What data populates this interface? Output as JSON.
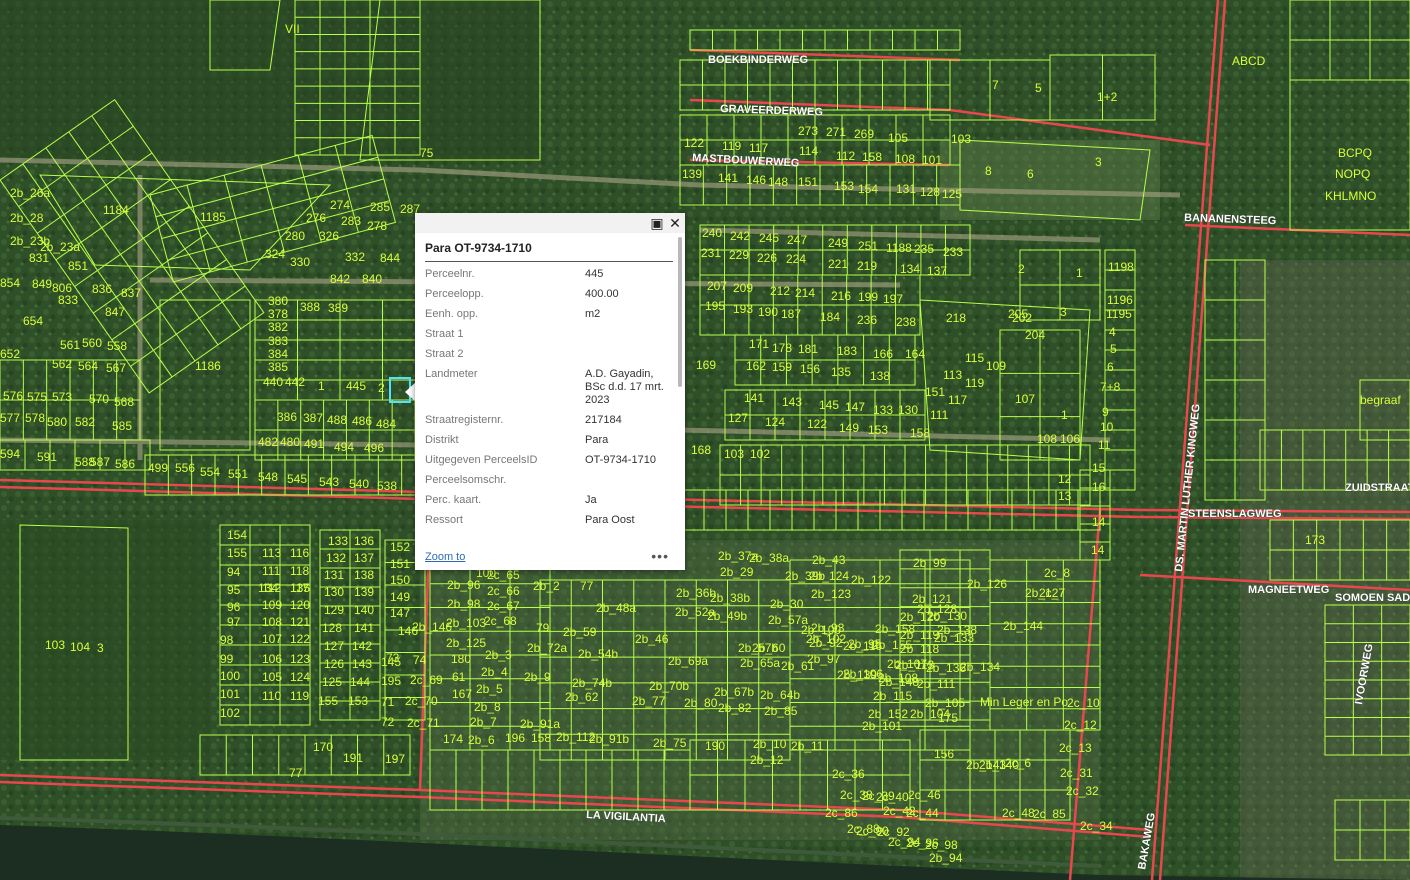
{
  "map": {
    "colors": {
      "parcel": "#b8ff4a",
      "road": "#e8474d",
      "label": "#d8ff3a",
      "highlight": "#4fe3ff"
    },
    "road_labels": [
      {
        "id": "boekbinderweg",
        "text": "BOEKBINDERWEG"
      },
      {
        "id": "graveerderweg",
        "text": "GRAVEERDERWEG"
      },
      {
        "id": "mastbouwerweg",
        "text": "MASTBOUWERWEG"
      },
      {
        "id": "bananensteeg",
        "text": "BANANENSTEEG"
      },
      {
        "id": "ds-martin-luther-kingweg",
        "text": "DS. MARTIN LUTHER KINGWEG"
      },
      {
        "id": "steenslagweg",
        "text": "STEENSLAGWEG"
      },
      {
        "id": "zuidstraat",
        "text": "ZUIDSTRAAT"
      },
      {
        "id": "magneetweg",
        "text": "MAGNEETWEG"
      },
      {
        "id": "somoen-sad",
        "text": "SOMOEN SAD"
      },
      {
        "id": "ivoorweg",
        "text": "IVOORWEG"
      },
      {
        "id": "la-vigilantia",
        "text": "LA VIGILANTIA"
      },
      {
        "id": "bakaweg",
        "text": "BAKAWEG"
      }
    ],
    "parcel_labels": [
      "VII",
      "1184",
      "1185",
      "1186",
      "75",
      "7",
      "5",
      "1+2",
      "3",
      "8",
      "6",
      "BCPQ",
      "NOPQ",
      "KHLMNO",
      "ABCD",
      "218",
      "107",
      "3",
      "2",
      "1",
      "205",
      "169",
      "168",
      "1",
      "108",
      "106",
      "103",
      "102",
      "100",
      "2b_2",
      "2b_43",
      "2b_99",
      "2b_127",
      "2b_144",
      "2b_146",
      "190",
      "175",
      "156",
      "154",
      "155",
      "94",
      "95",
      "96",
      "97",
      "98",
      "99",
      "100",
      "101",
      "102",
      "103",
      "104",
      "3",
      "2",
      "1",
      "445",
      "440",
      "442",
      "388",
      "389",
      "380",
      "378",
      "382",
      "383",
      "384",
      "385",
      "386",
      "387",
      "488",
      "486",
      "484",
      "482",
      "480",
      "491",
      "494",
      "496",
      "499",
      "556",
      "554",
      "551",
      "548",
      "545",
      "543",
      "540",
      "538",
      "594",
      "591",
      "588",
      "587",
      "586",
      "576",
      "575",
      "573",
      "570",
      "568",
      "577",
      "578",
      "580",
      "582",
      "585",
      "562",
      "564",
      "567",
      "654",
      "652",
      "561",
      "560",
      "558",
      "1198",
      "1196",
      "1195",
      "4",
      "5",
      "6",
      "7+8",
      "9",
      "10",
      "11",
      "15",
      "16",
      "12",
      "13",
      "14",
      "14",
      "Min Leger en Po",
      "begraaf",
      "173",
      "171",
      "178",
      "181",
      "183",
      "166",
      "164",
      "162",
      "159",
      "156",
      "135",
      "138",
      "141",
      "143",
      "145",
      "147",
      "133",
      "130",
      "127",
      "124",
      "122",
      "149",
      "153",
      "151",
      "115",
      "113",
      "117",
      "119",
      "111",
      "158",
      "109",
      "202",
      "204",
      "207",
      "209",
      "212",
      "214",
      "216",
      "199",
      "197",
      "195",
      "193",
      "190",
      "187",
      "184",
      "236",
      "238",
      "240",
      "242",
      "245",
      "247",
      "249",
      "251",
      "1188",
      "235",
      "233",
      "231",
      "229",
      "226",
      "224",
      "221",
      "219",
      "134",
      "137",
      "139",
      "141",
      "146",
      "148",
      "151",
      "153",
      "154",
      "131",
      "128",
      "125",
      "122",
      "119",
      "117",
      "114",
      "112",
      "158",
      "108",
      "101",
      "103",
      "105",
      "273",
      "271",
      "269",
      "274",
      "285",
      "287",
      "276",
      "283",
      "278",
      "280",
      "326",
      "324",
      "330",
      "332",
      "844",
      "842",
      "840",
      "836",
      "837",
      "847",
      "806",
      "833",
      "849",
      "851",
      "854",
      "831",
      "2b_23a",
      "2b_26a",
      "2b_23b",
      "2b_28",
      "2b_37a",
      "2b_38a",
      "2b_29",
      "2b_39b",
      "2b_36b",
      "2b_38b",
      "2b_30",
      "2b_48a",
      "2b_52a",
      "2b_49b",
      "2b_57a",
      "2b_59",
      "2b_46",
      "2b_54b",
      "2b_57b",
      "2b_60",
      "2b_72a",
      "2b_69a",
      "2b_65a",
      "2b_61",
      "2b_74b",
      "2b_70b",
      "2b_67b",
      "2b_64b",
      "2b_62",
      "2b_77",
      "2b_80",
      "2b_82",
      "2b_85",
      "2b_91a",
      "2b_112",
      "2b_91b",
      "2b_75",
      "2b_10",
      "2b_11",
      "2b_12",
      "2b_9",
      "2b_8",
      "2b_7",
      "2b_6",
      "2b_5",
      "2b_4",
      "2b_3",
      "2c_68",
      "2c_67",
      "2c_66",
      "2c_65",
      "2b_96",
      "2b_98",
      "2b_103",
      "2b_125",
      "2b_124",
      "2b_123",
      "2b_122",
      "2b_121",
      "2b_120",
      "2b_119",
      "2b_118",
      "2b_107",
      "2b_108",
      "2b_115",
      "2b_113",
      "2b_116",
      "2b_158",
      "2b_155",
      "2b_148",
      "2b_152",
      "2b_140",
      "2b_143",
      "2c_6",
      "2c_7",
      "2c_8",
      "2c_10",
      "2c_12",
      "2c_13",
      "2c_31",
      "2c_32",
      "2c_34",
      "2c_36",
      "2c_38",
      "2c_39",
      "2c_40",
      "2c_42",
      "2c_44",
      "2c_46",
      "2c_48",
      "2c_85",
      "2c_86",
      "2c_88",
      "2c_90",
      "2c_92",
      "2c_94",
      "2c_96",
      "2c_98",
      "2b_94",
      "2b_93",
      "2b_92",
      "2b_97",
      "2b_102",
      "2b_106",
      "2b_139",
      "2b_136",
      "2b_134",
      "2b_133",
      "2b_130",
      "2b_128",
      "2b_126",
      "2b_138",
      "2b_111",
      "2b_105",
      "2b_104",
      "2b_101",
      "2b_100",
      "2b_95",
      "113",
      "116",
      "111",
      "118",
      "112",
      "117",
      "109",
      "120",
      "108",
      "121",
      "107",
      "122",
      "106",
      "123",
      "105",
      "124",
      "110",
      "119",
      "134",
      "135",
      "133",
      "136",
      "132",
      "137",
      "131",
      "138",
      "130",
      "139",
      "129",
      "140",
      "128",
      "141",
      "127",
      "142",
      "126",
      "143",
      "125",
      "144",
      "155",
      "153",
      "152",
      "151",
      "150",
      "149",
      "147",
      "146",
      "145",
      "195",
      "71",
      "72",
      "73",
      "74",
      "2c_69",
      "2c_70",
      "2c_71",
      "180",
      "61",
      "167",
      "158",
      "174",
      "77",
      "79",
      "196",
      "197",
      "191",
      "170",
      "77"
    ]
  },
  "popup": {
    "title": "Para OT-9734-1710",
    "fields": [
      {
        "label": "Perceelnr.",
        "value": "445"
      },
      {
        "label": "Perceelopp.",
        "value": "400.00"
      },
      {
        "label": "Eenh. opp.",
        "value": "m2"
      },
      {
        "label": "Straat 1",
        "value": ""
      },
      {
        "label": "Straat 2",
        "value": ""
      },
      {
        "label": "Landmeter",
        "value": "A.D. Gayadin, BSc d.d. 17 mrt. 2023"
      },
      {
        "label": "Straatregisternr.",
        "value": "217184"
      },
      {
        "label": "Distrikt",
        "value": "Para"
      },
      {
        "label": "Uitgegeven PerceelsID",
        "value": "OT-9734-1710"
      },
      {
        "label": "Perceelsomschr.",
        "value": ""
      },
      {
        "label": "Perc. kaart.",
        "value": "Ja"
      },
      {
        "label": "Ressort",
        "value": "Para Oost"
      }
    ],
    "zoom_label": "Zoom to",
    "more_icon": "ellipsis-icon",
    "maximize_icon": "maximize-icon",
    "close_icon": "close-icon"
  }
}
